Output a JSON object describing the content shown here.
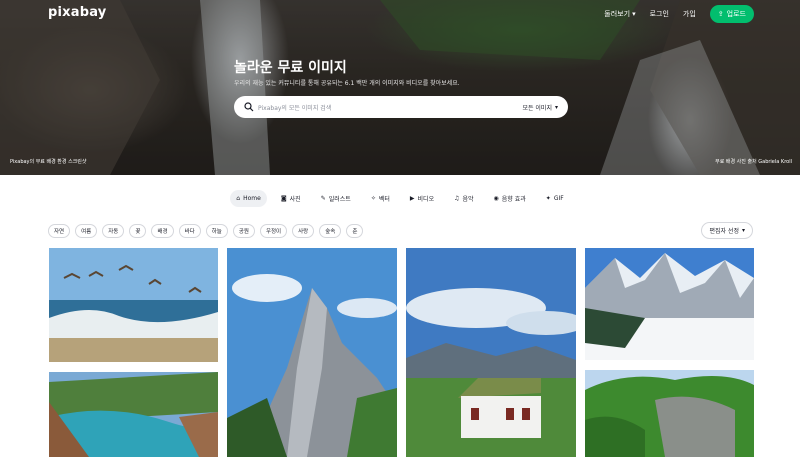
{
  "nav": {
    "logo": "pixabay",
    "explore": "둘러보기",
    "login": "로그인",
    "join": "가입",
    "upload": "업로드"
  },
  "hero": {
    "title": "놀라운 무료 이미지",
    "subtitle": "우리의 재능 있는 커뮤니티를 통해 공유되는 6.1 백만 개의 이미지와 비디오를 찾아보세요.",
    "credit_left": "Pixabay의 무료 배경 환경 스크린샷",
    "credit_right": "무료 배경 사진 출처 Gabriela Kroll"
  },
  "search": {
    "placeholder": "Pixabay의 모든 이미지 검색",
    "type": "모든 이미지"
  },
  "tabs": [
    {
      "label": "Home",
      "icon": "home-icon"
    },
    {
      "label": "사진",
      "icon": "camera-icon"
    },
    {
      "label": "일러스트",
      "icon": "brush-icon"
    },
    {
      "label": "벡터",
      "icon": "vector-icon"
    },
    {
      "label": "비디오",
      "icon": "video-icon"
    },
    {
      "label": "음악",
      "icon": "music-icon"
    },
    {
      "label": "음향 효과",
      "icon": "sound-icon"
    },
    {
      "label": "GIF",
      "icon": "gif-icon"
    }
  ],
  "chips": [
    "자연",
    "여름",
    "자동",
    "꽃",
    "배경",
    "바다",
    "하늘",
    "공원",
    "우정이",
    "사랑",
    "숲속",
    "춘"
  ],
  "editors_choice": "편집자 선정",
  "colors": {
    "accent": "#02be6e"
  }
}
